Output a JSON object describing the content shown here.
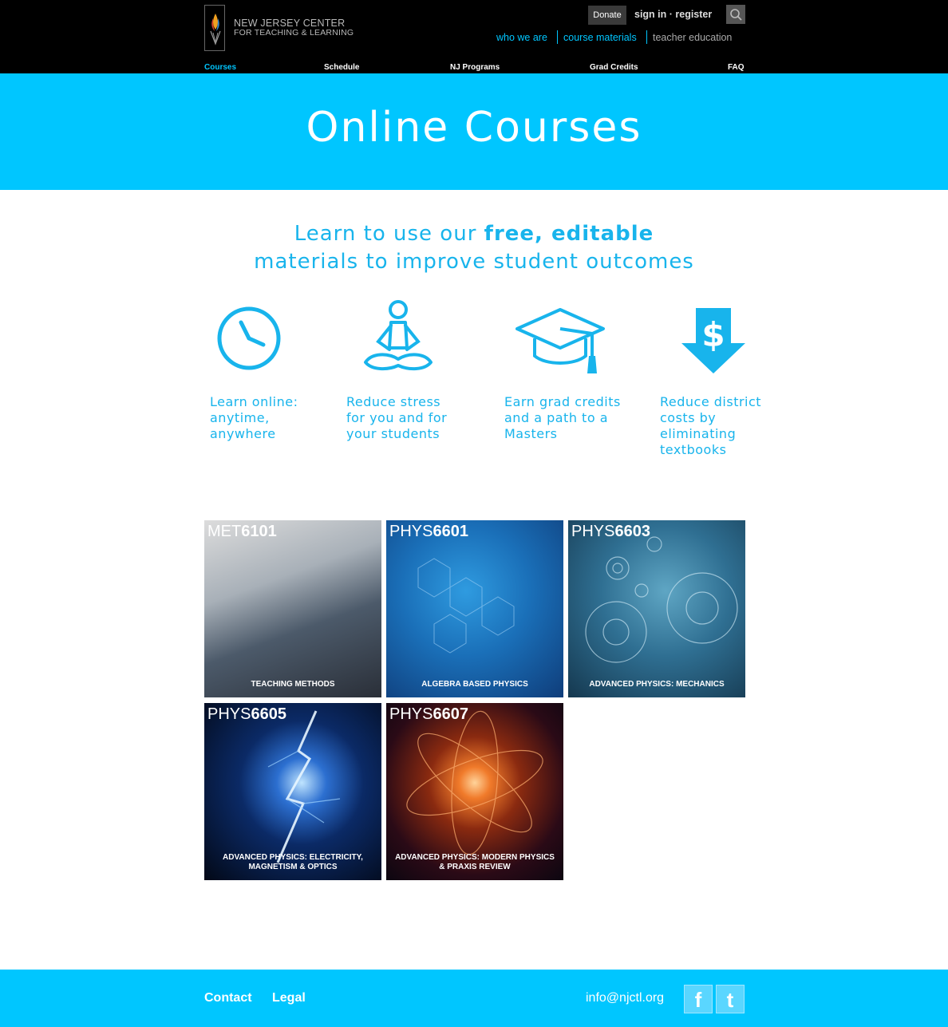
{
  "header": {
    "logo_line1": "NEW JERSEY CENTER",
    "logo_line2": "FOR TEACHING & LEARNING",
    "donate_label": "Donate",
    "signin_label": "sign in · register",
    "subnav": [
      "who we are",
      "course materials",
      "teacher education"
    ],
    "mainnav": [
      "Courses",
      "Schedule",
      "NJ Programs",
      "Grad Credits",
      "FAQ"
    ],
    "active_nav": "Courses"
  },
  "banner": {
    "title": "Online Courses"
  },
  "intro": {
    "line1_prefix": "Learn to use our ",
    "line1_bold": "free, editable",
    "line2": "materials to improve student outcomes"
  },
  "features": [
    {
      "icon": "clock-icon",
      "lines": [
        "Learn online:",
        "anytime,",
        "anywhere"
      ]
    },
    {
      "icon": "meditation-icon",
      "lines": [
        "Reduce stress",
        "for you and for",
        "your students"
      ]
    },
    {
      "icon": "graduation-cap-icon",
      "lines": [
        "Earn grad credits",
        "and a path to a",
        "Masters"
      ]
    },
    {
      "icon": "dollar-arrow-down-icon",
      "lines": [
        "Reduce district",
        "costs by",
        "eliminating",
        "textbooks"
      ]
    }
  ],
  "courses": [
    {
      "prefix": "MET",
      "number": "6101",
      "title": "TEACHING METHODS"
    },
    {
      "prefix": "PHYS",
      "number": "6601",
      "title": "ALGEBRA BASED PHYSICS"
    },
    {
      "prefix": "PHYS",
      "number": "6603",
      "title": "ADVANCED PHYSICS: MECHANICS"
    },
    {
      "prefix": "PHYS",
      "number": "6605",
      "title": "ADVANCED PHYSICS: ELECTRICITY, MAGNETISM & OPTICS"
    },
    {
      "prefix": "PHYS",
      "number": "6607",
      "title": "ADVANCED PHYSICS: MODERN PHYSICS & PRAXIS REVIEW"
    }
  ],
  "footer": {
    "links": [
      "Contact",
      "Legal"
    ],
    "email": "info@njctl.org",
    "social": [
      "facebook-icon",
      "twitter-icon"
    ]
  },
  "colors": {
    "accent": "#00c6ff",
    "text_accent": "#18b4ec",
    "header_bg": "#000000"
  }
}
